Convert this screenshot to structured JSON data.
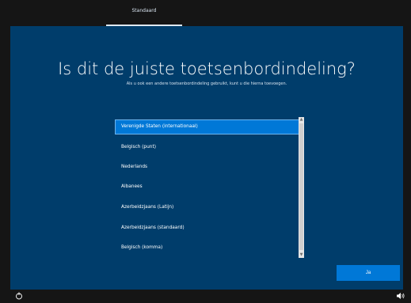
{
  "header": {
    "tab_label": "Standaard"
  },
  "page": {
    "title": "Is dit de juiste toetsenbordindeling?",
    "subtitle": "Als u ook een andere toetsenbordindeling gebruikt, kunt u die hierna toevoegen."
  },
  "layouts": {
    "items": [
      "Verenigde Staten (internationaal)",
      "Belgisch (punt)",
      "Nederlands",
      "Albanees",
      "Azerbeidzjaans (Latijn)",
      "Azerbeidzjaans (standaard)",
      "Belgisch (komma)"
    ],
    "selected": "Verenigde Staten (internationaal)"
  },
  "actions": {
    "yes_label": "Ja"
  },
  "icons": {
    "bottom_left": "accessibility-icon",
    "bottom_right": "volume-icon"
  },
  "colors": {
    "background": "#003d6b",
    "accent": "#0078d7",
    "chrome": "#151515"
  }
}
